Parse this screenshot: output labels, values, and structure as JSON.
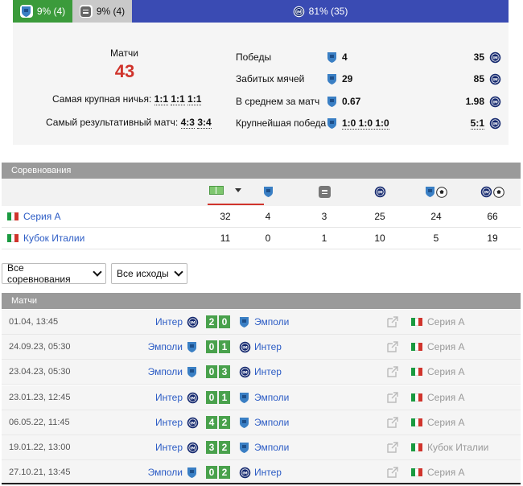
{
  "colors": {
    "home": "#3b9b3b",
    "draw": "#c9c9c9",
    "away": "#3a4bb3",
    "accent": "#d0342c",
    "link": "#2c5cc5"
  },
  "result_bar": {
    "home": {
      "text": "9% (4)",
      "icon": "empoli-crest-icon"
    },
    "draw": {
      "text": "9% (4)",
      "icon": "draw-equals-icon"
    },
    "away": {
      "text": "81% (35)",
      "icon": "inter-crest-icon"
    }
  },
  "summary": {
    "matches_label": "Матчи",
    "matches_count": "43",
    "biggest_draw_label": "Самая крупная ничья:",
    "biggest_draw_scores": [
      "1:1",
      "1:1",
      "1:1"
    ],
    "highest_scoring_label": "Самый результативный матч:",
    "highest_scoring_scores": [
      "4:3",
      "3:4"
    ],
    "stats": [
      {
        "label": "Победы",
        "home": "4",
        "away": "35"
      },
      {
        "label": "Забитых мячей",
        "home": "29",
        "away": "85"
      },
      {
        "label": "В среднем за матч",
        "home": "0.67",
        "away": "1.98"
      },
      {
        "label": "Крупнейшая победа",
        "home": "1:0 1:0 1:0",
        "away": "5:1"
      }
    ]
  },
  "competitions": {
    "title": "Соревнования",
    "rows": [
      {
        "name": "Серия А",
        "values": [
          "32",
          "4",
          "3",
          "25",
          "24",
          "66"
        ]
      },
      {
        "name": "Кубок Италии",
        "values": [
          "11",
          "0",
          "1",
          "10",
          "5",
          "19"
        ]
      }
    ]
  },
  "filters": {
    "competition": "Все соревнования",
    "outcome": "Все исходы"
  },
  "matches": {
    "title": "Матчи",
    "rows": [
      {
        "date": "01.04, 13:45",
        "home": "Интер",
        "home_club": "inter",
        "score": [
          "2",
          "0"
        ],
        "away": "Эмполи",
        "away_club": "empoli",
        "competition": "Серия А"
      },
      {
        "date": "24.09.23, 05:30",
        "home": "Эмполи",
        "home_club": "empoli",
        "score": [
          "0",
          "1"
        ],
        "away": "Интер",
        "away_club": "inter",
        "competition": "Серия А"
      },
      {
        "date": "23.04.23, 05:30",
        "home": "Эмполи",
        "home_club": "empoli",
        "score": [
          "0",
          "3"
        ],
        "away": "Интер",
        "away_club": "inter",
        "competition": "Серия А"
      },
      {
        "date": "23.01.23, 12:45",
        "home": "Интер",
        "home_club": "inter",
        "score": [
          "0",
          "1"
        ],
        "away": "Эмполи",
        "away_club": "empoli",
        "competition": "Серия А"
      },
      {
        "date": "06.05.22, 11:45",
        "home": "Интер",
        "home_club": "inter",
        "score": [
          "4",
          "2"
        ],
        "away": "Эмполи",
        "away_club": "empoli",
        "competition": "Серия А"
      },
      {
        "date": "19.01.22, 13:00",
        "home": "Интер",
        "home_club": "inter",
        "score": [
          "3",
          "2"
        ],
        "away": "Эмполи",
        "away_club": "empoli",
        "competition": "Кубок Италии"
      },
      {
        "date": "27.10.21, 13:45",
        "home": "Эмполи",
        "home_club": "empoli",
        "score": [
          "0",
          "2"
        ],
        "away": "Интер",
        "away_club": "inter",
        "competition": "Серия А"
      }
    ]
  }
}
